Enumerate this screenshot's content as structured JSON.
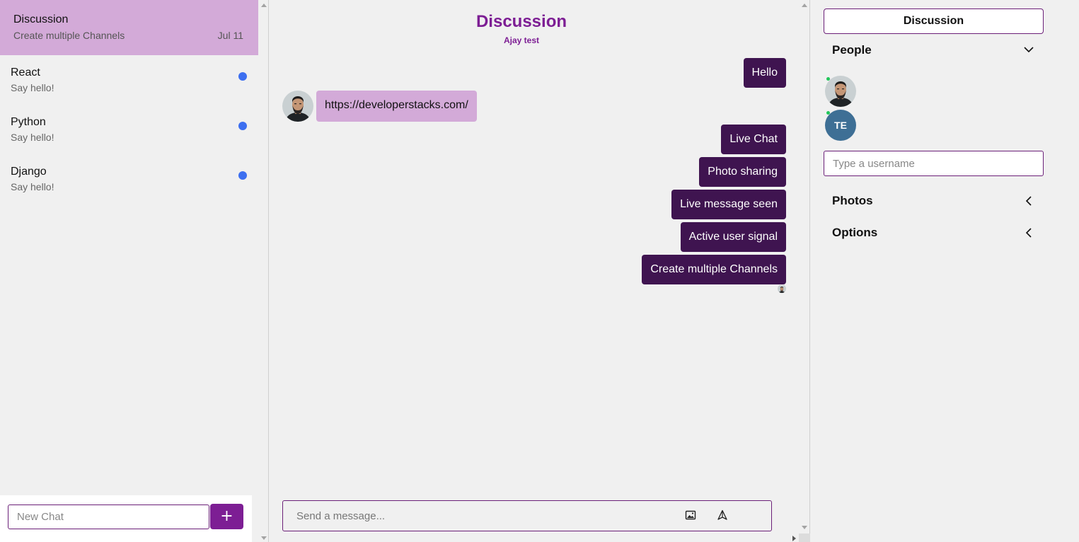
{
  "sidebar": {
    "channels": [
      {
        "title": "Discussion",
        "subtitle": "Create multiple Channels",
        "date": "Jul 11",
        "active": true
      },
      {
        "title": "React",
        "subtitle": "Say hello!",
        "unread": true
      },
      {
        "title": "Python",
        "subtitle": "Say hello!",
        "unread": true
      },
      {
        "title": "Django",
        "subtitle": "Say hello!",
        "unread": true
      }
    ],
    "new_chat_placeholder": "New Chat",
    "new_chat_button": "+"
  },
  "chat": {
    "title": "Discussion",
    "subtitle": "Ajay test",
    "messages": [
      {
        "direction": "out",
        "text": "Hello"
      },
      {
        "direction": "in",
        "text": "https://developerstacks.com/"
      },
      {
        "direction": "out",
        "text": "Live Chat"
      },
      {
        "direction": "out",
        "text": "Photo sharing"
      },
      {
        "direction": "out",
        "text": "Live message seen"
      },
      {
        "direction": "out",
        "text": "Active user signal"
      },
      {
        "direction": "out",
        "text": "Create multiple Channels"
      }
    ],
    "composer_placeholder": "Send a message...",
    "composer_icons": [
      "image-upload-icon",
      "send-icon"
    ]
  },
  "settings": {
    "channel_name": "Discussion",
    "people_label": "People",
    "people": [
      {
        "type": "photo",
        "online": true
      },
      {
        "type": "initials",
        "initials": "TE",
        "online": true
      }
    ],
    "username_placeholder": "Type a username",
    "photos_label": "Photos",
    "options_label": "Options"
  },
  "colors": {
    "accent": "#7d1e94",
    "outgoing_bubble": "#3f1450",
    "incoming_bubble": "#d3aad8",
    "unread_dot": "#3d6ff0",
    "online_dot": "#21c65a",
    "initials_avatar": "#3e6f95"
  }
}
